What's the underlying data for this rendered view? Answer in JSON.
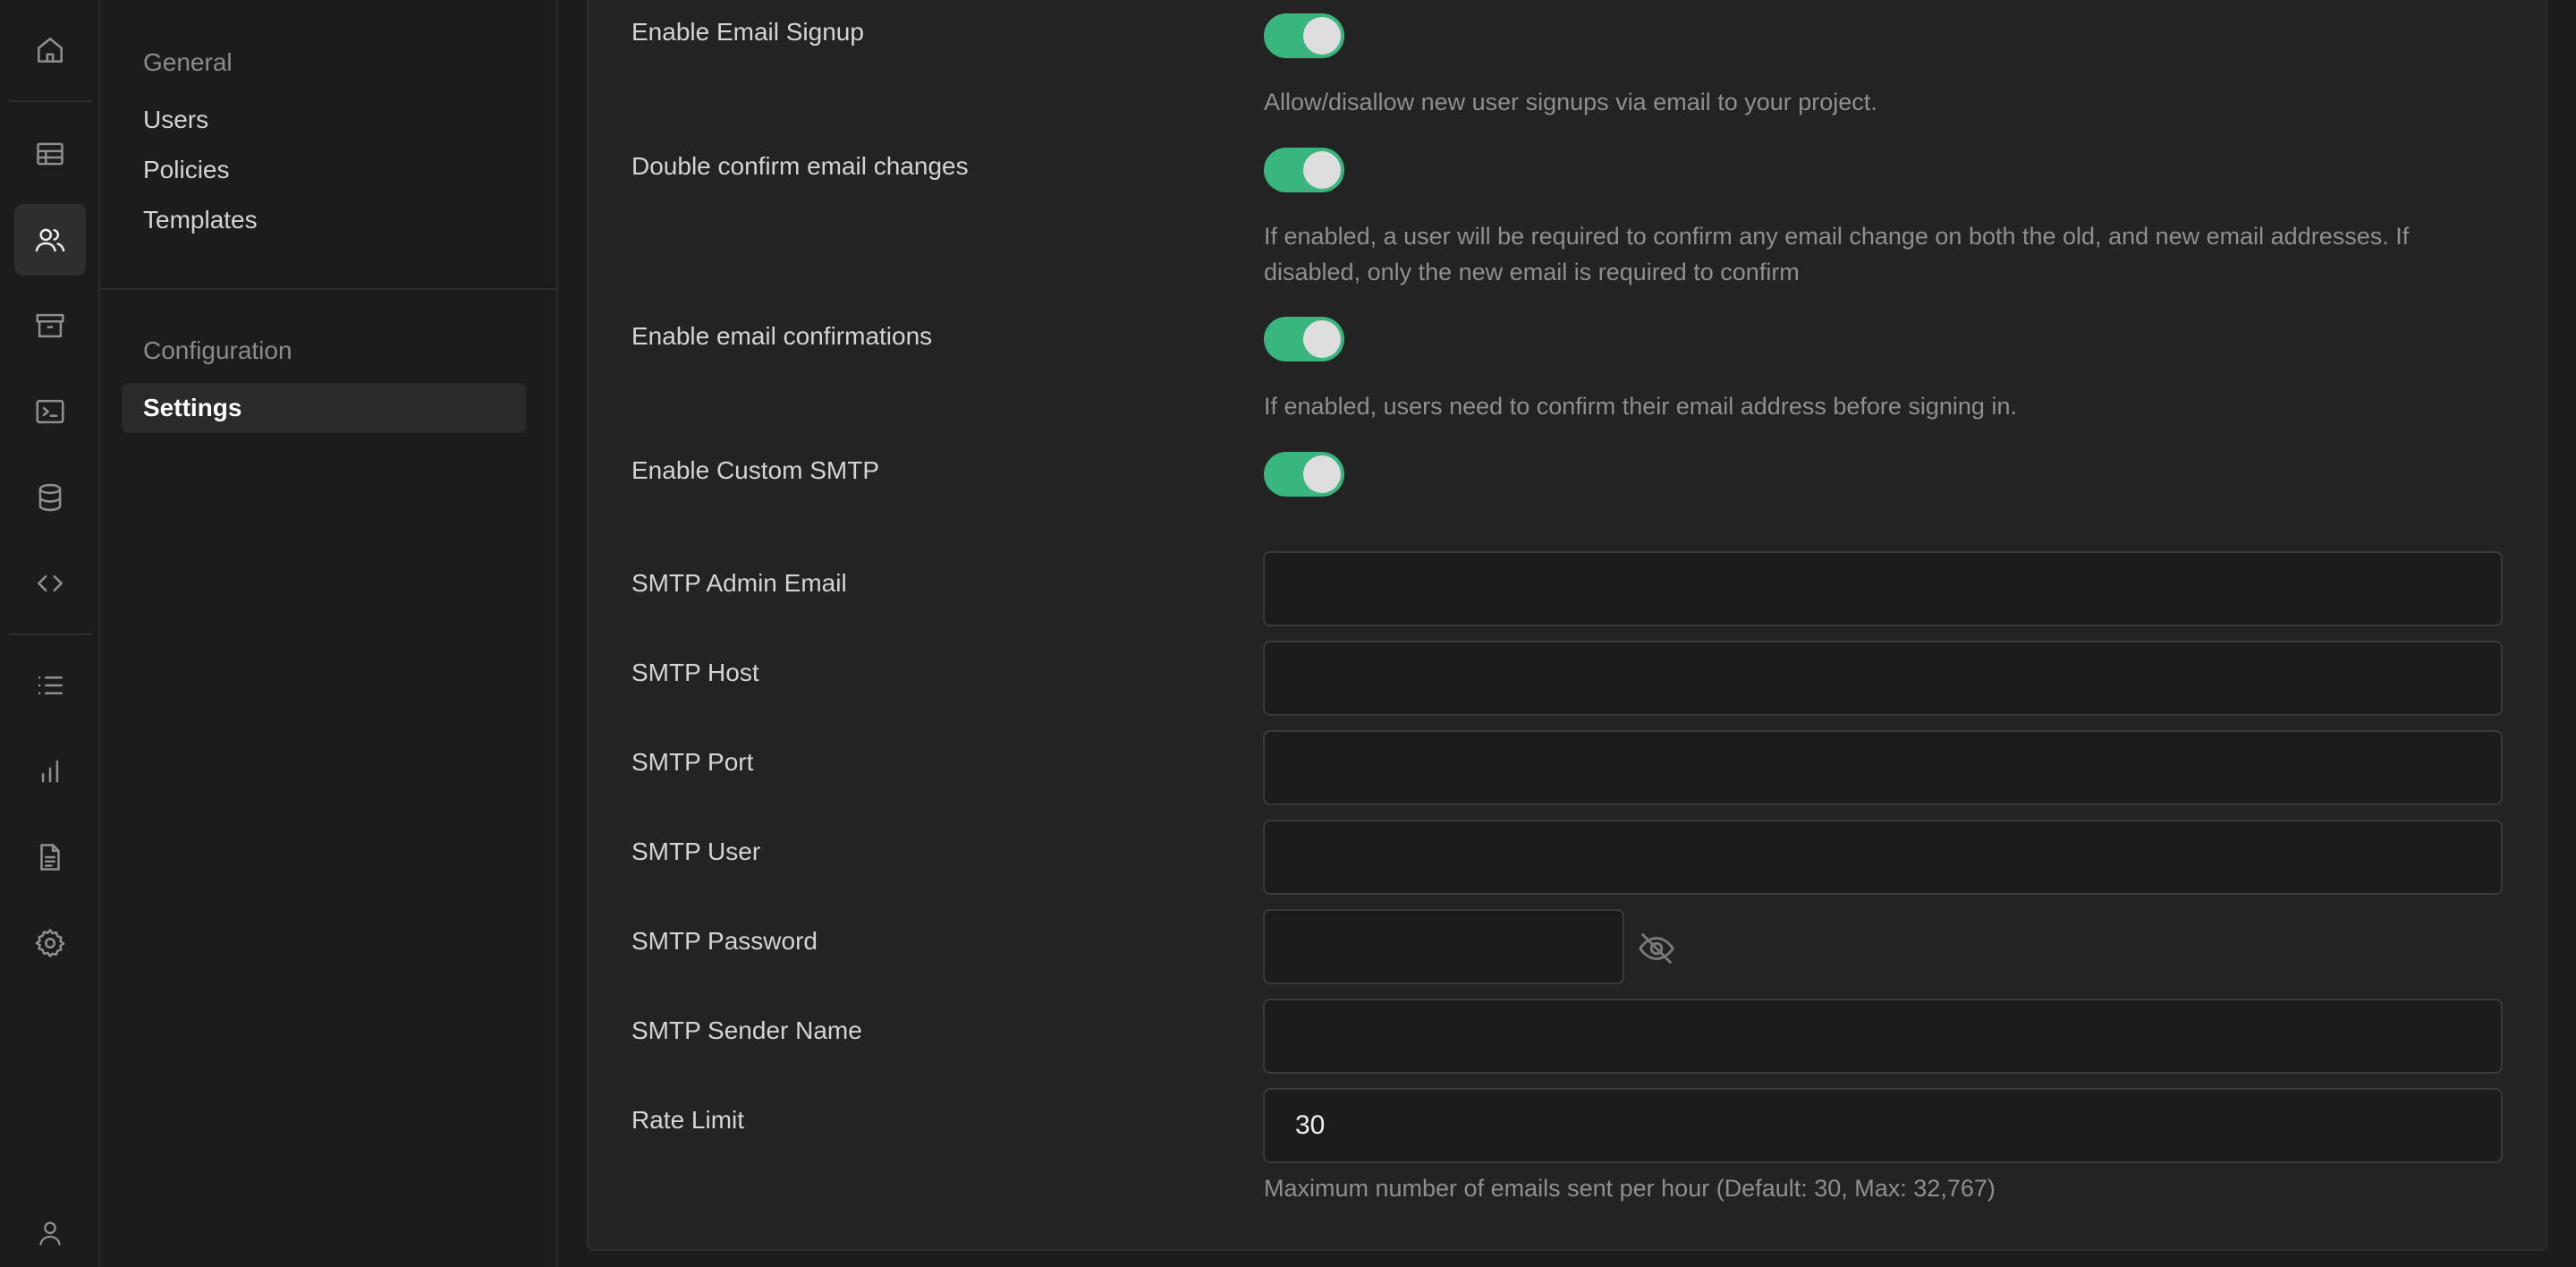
{
  "submenu": {
    "groups": [
      {
        "title": "General",
        "items": [
          "Users",
          "Policies",
          "Templates"
        ]
      },
      {
        "title": "Configuration",
        "items": [
          "Settings"
        ]
      }
    ]
  },
  "settings": {
    "toggles": [
      {
        "label": "Enable Email Signup",
        "description": "Allow/disallow new user signups via email to your project.",
        "enabled": true
      },
      {
        "label": "Double confirm email changes",
        "description": "If enabled, a user will be required to confirm any email change on both the old, and new email addresses. If disabled, only the new email is required to confirm",
        "enabled": true
      },
      {
        "label": "Enable email confirmations",
        "description": "If enabled, users need to confirm their email address before signing in.",
        "enabled": true
      },
      {
        "label": "Enable Custom SMTP",
        "description": "",
        "enabled": true
      }
    ],
    "smtp": {
      "admin_email": {
        "label": "SMTP Admin Email",
        "value": ""
      },
      "host": {
        "label": "SMTP Host",
        "value": ""
      },
      "port": {
        "label": "SMTP Port",
        "value": ""
      },
      "user": {
        "label": "SMTP User",
        "value": ""
      },
      "password": {
        "label": "SMTP Password",
        "value": ""
      },
      "sender_name": {
        "label": "SMTP Sender Name",
        "value": ""
      },
      "rate_limit": {
        "label": "Rate Limit",
        "value": "30",
        "description": "Maximum number of emails sent per hour (Default: 30, Max: 32,767)"
      }
    }
  },
  "colors": {
    "toggle_on": "#3ecf8e",
    "background": "#1c1c1c",
    "panel": "#232323"
  },
  "icons": [
    "home-icon",
    "table-icon",
    "users-icon",
    "archive-icon",
    "terminal-icon",
    "database-icon",
    "code-icon",
    "list-icon",
    "bar-chart-icon",
    "document-icon",
    "settings-icon",
    "user-icon",
    "eye-off-icon"
  ]
}
